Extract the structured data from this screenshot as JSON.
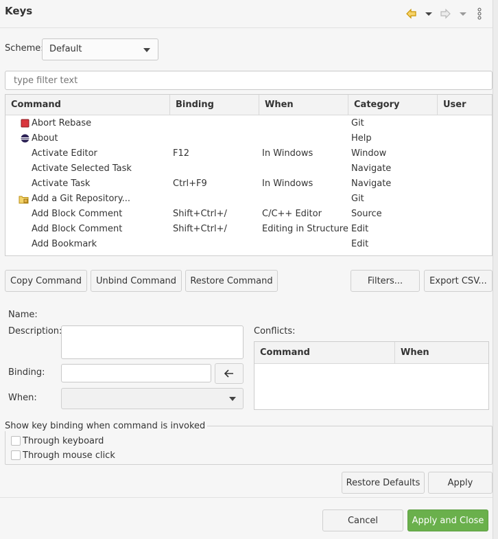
{
  "header": {
    "title": "Keys"
  },
  "scheme": {
    "label": "Scheme:",
    "value": "Default"
  },
  "filter": {
    "placeholder": "type filter text"
  },
  "table": {
    "columns": [
      "Command",
      "Binding",
      "When",
      "Category",
      "User"
    ],
    "rows": [
      {
        "command": "Abort Rebase",
        "binding": "",
        "when": "",
        "category": "Git",
        "icon": "git-stop-icon"
      },
      {
        "command": "About",
        "binding": "",
        "when": "",
        "category": "Help",
        "icon": "eclipse-icon"
      },
      {
        "command": "Activate Editor",
        "binding": "F12",
        "when": "In Windows",
        "category": "Window",
        "icon": ""
      },
      {
        "command": "Activate Selected Task",
        "binding": "",
        "when": "",
        "category": "Navigate",
        "icon": ""
      },
      {
        "command": "Activate Task",
        "binding": "Ctrl+F9",
        "when": "In Windows",
        "category": "Navigate",
        "icon": ""
      },
      {
        "command": "Add a Git Repository...",
        "binding": "",
        "when": "",
        "category": "Git",
        "icon": "git-repo-folder-icon"
      },
      {
        "command": "Add Block Comment",
        "binding": "Shift+Ctrl+/",
        "when": "C/C++ Editor",
        "category": "Source",
        "icon": ""
      },
      {
        "command": "Add Block Comment",
        "binding": "Shift+Ctrl+/",
        "when": "Editing in Structured",
        "category": "Edit",
        "icon": ""
      },
      {
        "command": "Add Bookmark",
        "binding": "",
        "when": "",
        "category": "Edit",
        "icon": ""
      }
    ]
  },
  "buttons": {
    "copy": "Copy Command",
    "unbind": "Unbind Command",
    "restore": "Restore Command",
    "filters": "Filters...",
    "export": "Export CSV...",
    "restore_defaults": "Restore Defaults",
    "apply": "Apply",
    "cancel": "Cancel",
    "apply_close": "Apply and Close"
  },
  "details": {
    "name_label": "Name:",
    "description_label": "Description:",
    "binding_label": "Binding:",
    "when_label": "When:",
    "conflicts_label": "Conflicts:",
    "conflicts_columns": [
      "Command",
      "When"
    ]
  },
  "show_binding": {
    "legend": "Show key binding when command is invoked",
    "keyboard": "Through keyboard",
    "mouse": "Through mouse click"
  },
  "colors": {
    "accent": "#6ab04c",
    "nav_arrow": "#e0a800"
  }
}
